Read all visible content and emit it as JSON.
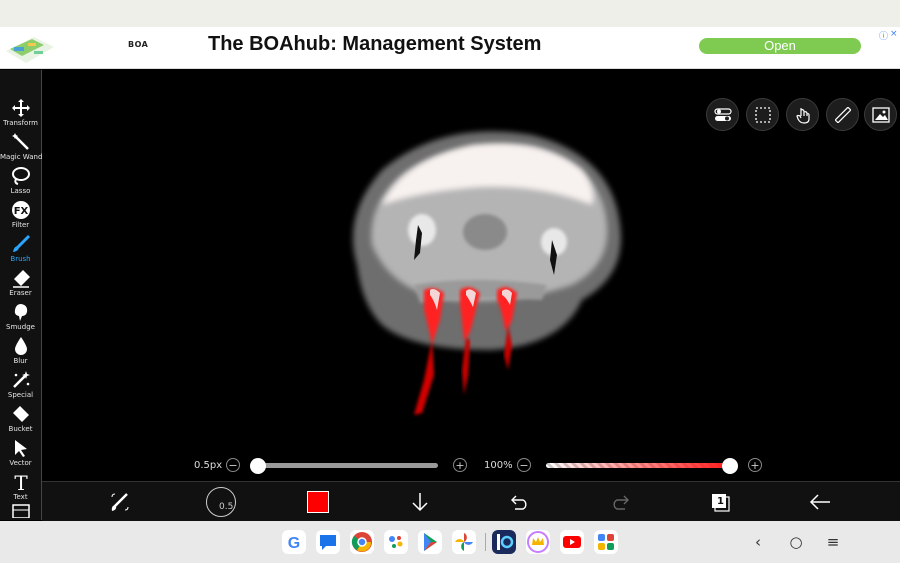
{
  "ad": {
    "logo_text": "BOA",
    "title": "The BOAhub: Management System",
    "open_label": "Open",
    "info_glyph": "ⓘ",
    "close_glyph": "×"
  },
  "tools": [
    {
      "label": "Transform",
      "icon": "transform-icon"
    },
    {
      "label": "Magic Wand",
      "icon": "magic-wand-icon"
    },
    {
      "label": "Lasso",
      "icon": "lasso-icon"
    },
    {
      "label": "Filter",
      "icon": "fx-icon",
      "glyph": "FX"
    },
    {
      "label": "Brush",
      "icon": "brush-icon",
      "active": true
    },
    {
      "label": "Eraser",
      "icon": "eraser-icon"
    },
    {
      "label": "Smudge",
      "icon": "smudge-icon"
    },
    {
      "label": "Blur",
      "icon": "blur-drop-icon"
    },
    {
      "label": "Special",
      "icon": "special-wand-icon"
    },
    {
      "label": "Bucket",
      "icon": "bucket-icon"
    },
    {
      "label": "Vector",
      "icon": "vector-cursor-icon"
    },
    {
      "label": "Text",
      "icon": "text-icon",
      "glyph": "T"
    }
  ],
  "sliders": {
    "size_value": "0.5px",
    "size_fraction": 0.0,
    "opacity_value": "100%",
    "opacity_fraction": 1.0,
    "minus": "−",
    "plus": "+"
  },
  "bottom": {
    "brush_size_label": "0.5",
    "color": "#ff0000",
    "layer_count": "1"
  },
  "nav": {
    "back": "‹",
    "home": "○",
    "menu": "≡"
  },
  "colors": {
    "accent_blue": "#2aa6ff",
    "ad_button": "#7fcb52",
    "brush_color": "#ff0000"
  }
}
